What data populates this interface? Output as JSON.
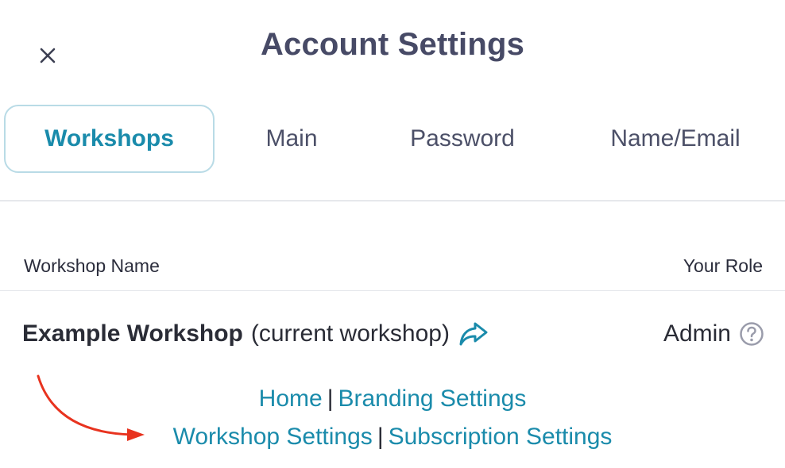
{
  "header": {
    "title": "Account Settings",
    "close_icon": "close-icon"
  },
  "tabs": [
    {
      "label": "Workshops",
      "active": true
    },
    {
      "label": "Main",
      "active": false
    },
    {
      "label": "Password",
      "active": false
    },
    {
      "label": "Name/Email",
      "active": false
    }
  ],
  "table": {
    "columns": {
      "name": "Workshop Name",
      "role": "Your Role"
    },
    "rows": [
      {
        "name": "Example Workshop",
        "note": "(current workshop)",
        "role": "Admin",
        "links_line1": [
          "Home",
          "Branding Settings"
        ],
        "links_line2": [
          "Workshop Settings",
          "Subscription Settings"
        ],
        "separator": "|"
      }
    ]
  },
  "colors": {
    "accent": "#1a8bab",
    "title": "#474a66",
    "annotation_arrow": "#e8331f"
  }
}
